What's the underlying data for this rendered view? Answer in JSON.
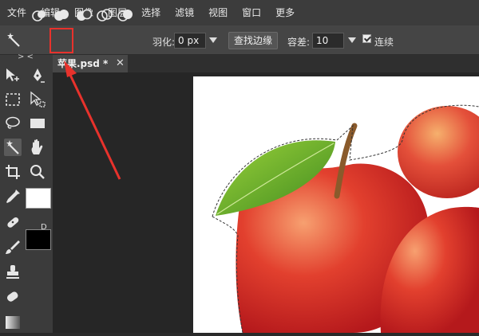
{
  "menu": [
    "文件",
    "编辑",
    "图像",
    "图层",
    "选择",
    "滤镜",
    "视图",
    "窗口",
    "更多"
  ],
  "options": {
    "feather_label": "羽化:",
    "feather_value": "0 px",
    "find_edges_label": "查找边缘",
    "tolerance_label": "容差:",
    "tolerance_value": "10",
    "contiguous_label": "连续"
  },
  "toolbar": {
    "collapse_label": "> <",
    "default_colors_label": "D"
  },
  "document": {
    "tab_label": "苹果.psd *",
    "close_glyph": "✕"
  },
  "colors": {
    "highlight": "#e8322c",
    "arrow": "#e8322c",
    "foreground": "#ffffff",
    "background": "#000000"
  },
  "icons": [
    "magic-wand-icon",
    "new-selection-icon",
    "add-to-selection-icon",
    "subtract-selection-icon",
    "intersect-selection-icon",
    "exclude-selection-icon"
  ]
}
